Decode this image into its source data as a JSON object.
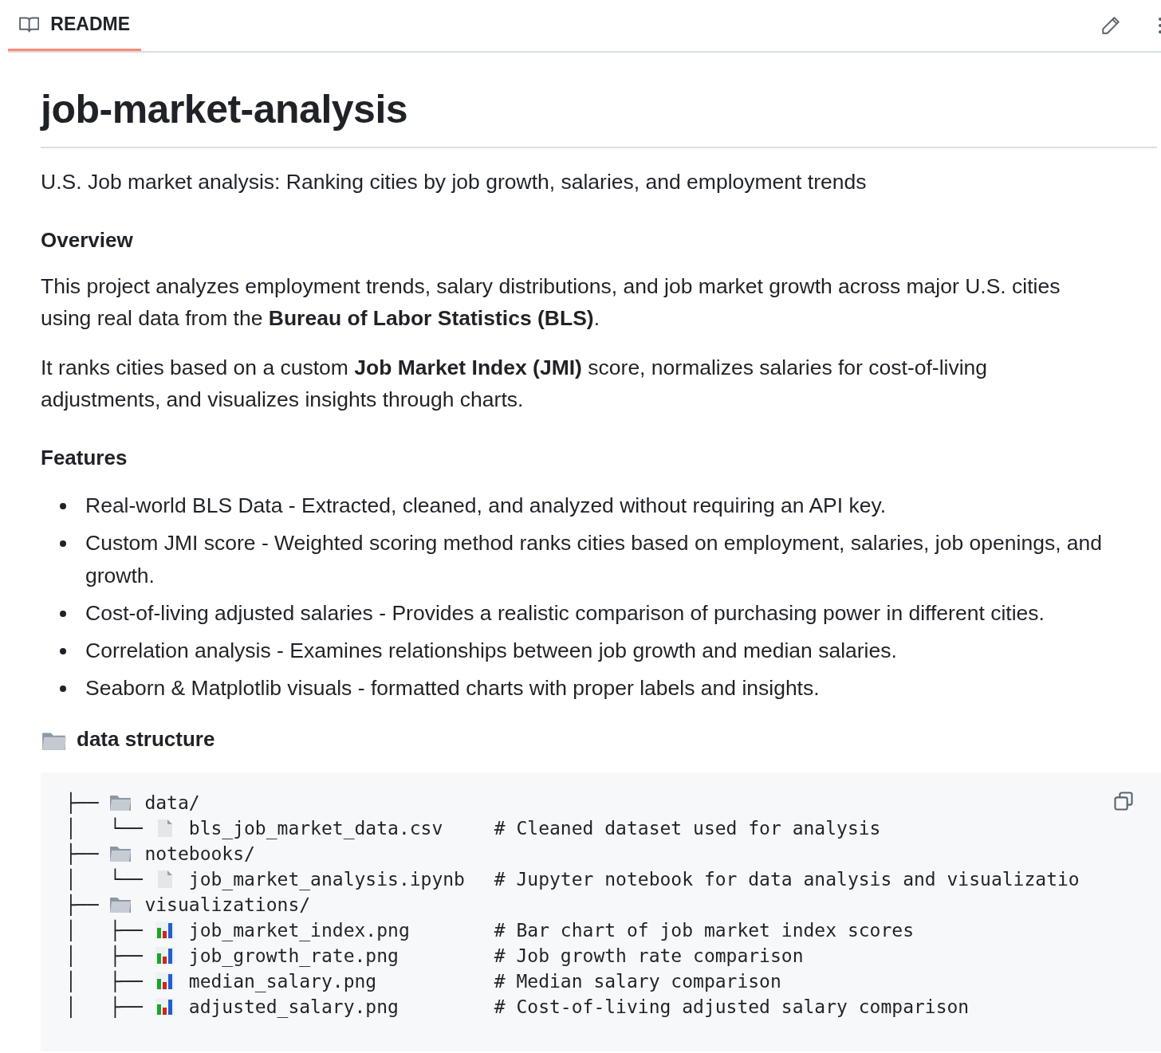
{
  "tabs": [
    {
      "label": "README",
      "selected": true
    }
  ],
  "title": "job-market-analysis",
  "tagline": "U.S. Job market analysis: Ranking cities by job growth, salaries, and employment trends",
  "sections": [
    {
      "heading": "Overview",
      "paragraphs": [
        "This project analyzes employment trends, salary distributions, and job market growth across major U.S. cities using real data from the **Bureau of Labor Statistics (BLS)**.",
        "It ranks cities based on a custom **Job Market Index (JMI)** score, normalizes salaries for cost-of-living adjustments, and visualizes insights through charts."
      ]
    },
    {
      "heading": "Features",
      "items": [
        "Real-world BLS Data - Extracted, cleaned, and analyzed without requiring an API key.",
        "Custom JMI score - Weighted scoring method ranks cities based on employment, salaries, job openings, and growth.",
        "Cost-of-living adjusted salaries - Provides a realistic comparison of purchasing power in different cities.",
        "Correlation analysis - Examines relationships between job growth and median salaries.",
        "Seaborn & Matplotlib visuals - formatted charts with proper labels and insights."
      ]
    }
  ],
  "structure": {
    "heading": "data structure",
    "rows": [
      {
        "prefix": "├── ",
        "kind": "folder",
        "name": "data/"
      },
      {
        "prefix": "│   └── ",
        "kind": "file",
        "name": "bls_job_market_data.csv",
        "comment": "# Cleaned dataset used for analysis"
      },
      {
        "prefix": "├── ",
        "kind": "folder",
        "name": "notebooks/"
      },
      {
        "prefix": "│   └── ",
        "kind": "file",
        "name": "job_market_analysis.ipynb",
        "comment": "# Jupyter notebook for data analysis and visualizatio"
      },
      {
        "prefix": "├── ",
        "kind": "folder",
        "name": "visualizations/"
      },
      {
        "prefix": "│   ├── ",
        "kind": "chart",
        "name": "job_market_index.png",
        "comment": "# Bar chart of job market index scores"
      },
      {
        "prefix": "│   ├── ",
        "kind": "chart",
        "name": "job_growth_rate.png",
        "comment": "# Job growth rate comparison"
      },
      {
        "prefix": "│   ├── ",
        "kind": "chart",
        "name": "median_salary.png",
        "comment": "# Median salary comparison"
      },
      {
        "prefix": "│   ├── ",
        "kind": "chart",
        "name": "adjusted_salary.png",
        "comment": "# Cost-of-living adjusted salary comparison"
      }
    ]
  }
}
